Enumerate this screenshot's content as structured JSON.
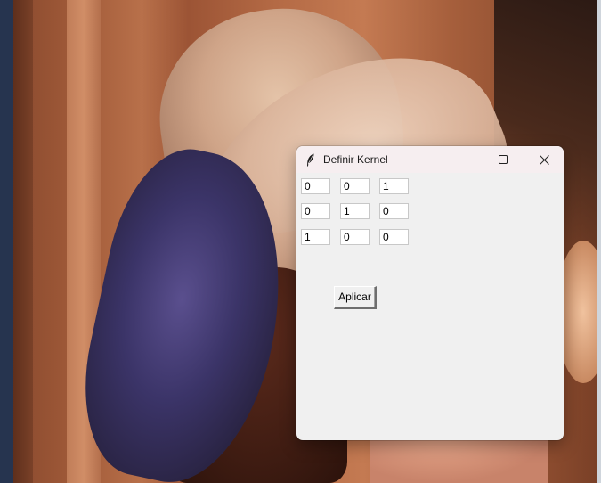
{
  "window": {
    "title": "Definir Kernel",
    "icon": "feather-icon"
  },
  "title_buttons": {
    "minimize": "minimize-icon",
    "maximize": "maximize-icon",
    "close": "close-icon"
  },
  "kernel": {
    "rows": [
      [
        "0",
        "0",
        "1"
      ],
      [
        "0",
        "1",
        "0"
      ],
      [
        "1",
        "0",
        "0"
      ]
    ]
  },
  "actions": {
    "apply_label": "Aplicar"
  },
  "background": {
    "description_icon": "lena-photo"
  }
}
